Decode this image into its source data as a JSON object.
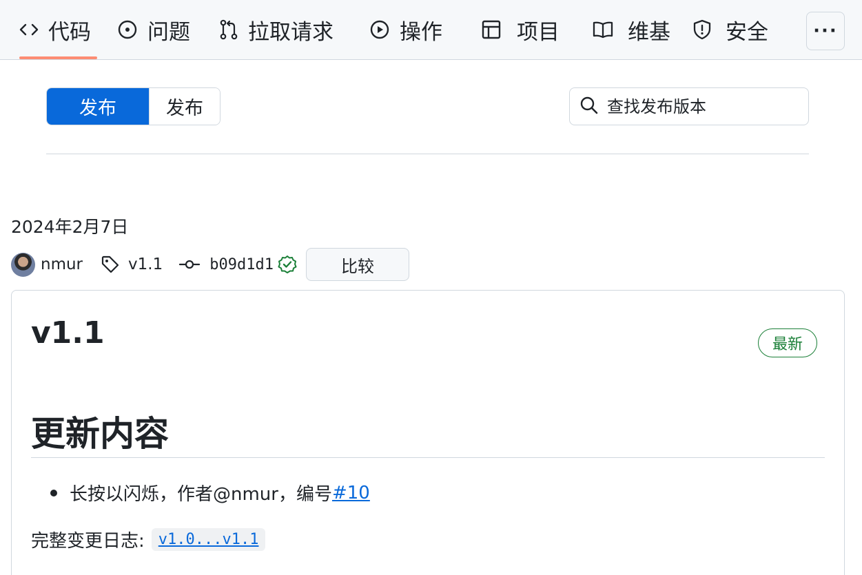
{
  "nav": {
    "tabs": [
      {
        "label": "代码",
        "icon": "code-icon",
        "active": true
      },
      {
        "label": "问题",
        "icon": "issue-opened-icon"
      },
      {
        "label": "拉取请求",
        "icon": "git-pull-request-icon"
      },
      {
        "label": "操作",
        "icon": "play-icon"
      },
      {
        "label": "项目",
        "icon": "table-icon"
      },
      {
        "label": "维基",
        "icon": "book-icon"
      },
      {
        "label": "安全",
        "icon": "shield-icon"
      }
    ],
    "more_label": "···",
    "active_color": "#fd8c73"
  },
  "segment": {
    "releases_label": "发布",
    "tags_label": "发布",
    "selected_color": "#0969da"
  },
  "search": {
    "placeholder": "查找发布版本",
    "icon": "search-icon"
  },
  "release": {
    "date": "2024年2月7日",
    "author": "nmur",
    "tag": "v1.1",
    "commit": "b09d1d1",
    "compare_label": "比较",
    "title": "v1.1",
    "latest_badge": "最新",
    "section_heading": "更新内容",
    "changes": [
      {
        "text": "长按以闪烁，作者@nmur，编号",
        "link": "#10"
      }
    ],
    "full_changelog_label": "完整变更日志:",
    "full_changelog_link": "v1.0...v1.1"
  },
  "colors": {
    "link": "#0969da",
    "verified": "#1a7f37"
  }
}
